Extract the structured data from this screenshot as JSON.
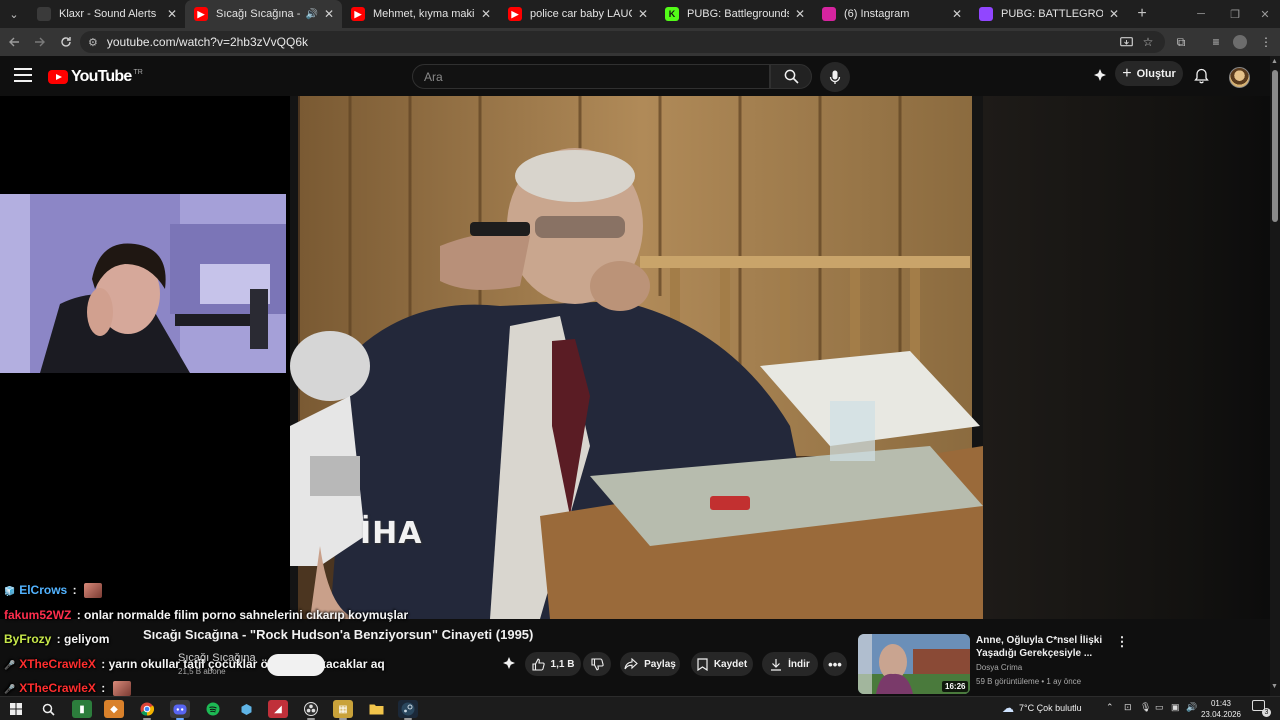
{
  "browser": {
    "tabs": [
      {
        "title": "Klaxr - Sound Alerts",
        "favicon": "globe-icon",
        "color": "#3a3a3a",
        "active": false
      },
      {
        "title": "Sıcağı Sıcağına - \"Rock Hudson'a Benziyorsun\" Cinayeti (1995)",
        "favicon": "youtube-icon",
        "color": "#ff0000",
        "active": true,
        "audio": true
      },
      {
        "title": "Mehmet, kıyma makinesi cinayeti",
        "favicon": "youtube-icon",
        "color": "#ff0000",
        "active": false
      },
      {
        "title": "police car baby LAUGH - YouTube",
        "favicon": "youtube-icon",
        "color": "#ff0000",
        "active": false
      },
      {
        "title": "PUBG: Battlegrounds Streaming",
        "favicon": "kick-icon",
        "color": "#53fc18",
        "active": false
      },
      {
        "title": "(6) Instagram",
        "favicon": "instagram-icon",
        "color": "#d6249f",
        "active": false
      },
      {
        "title": "PUBG: BATTLEGROUNDS - Twitch",
        "favicon": "twitch-icon",
        "color": "#9146ff",
        "active": false
      }
    ],
    "url": "youtube.com/watch?v=2hb3zVvQQ6k"
  },
  "youtube": {
    "country": "TR",
    "search_placeholder": "Ara",
    "create_label": "Oluştur"
  },
  "video": {
    "title": "Sıcağı Sıcağına - \"Rock Hudson'a Benziyorsun\" Cinayeti (1995)",
    "watermark": "İHA",
    "channel": "Sıcağı Sıcağına",
    "subscribers": "21,5 B abone",
    "likes": "1,1 B",
    "share_label": "Paylaş",
    "save_label": "Kaydet",
    "download_label": "İndir"
  },
  "chat": [
    {
      "user": "ElCrows",
      "color": "#52b3ff",
      "text": "",
      "emote": true,
      "badge": "🧊"
    },
    {
      "user": "fakum52WZ",
      "color": "#ff2e4d",
      "text": "onlar normalde filim porno sahnelerini cıkarıp koymuşlar",
      "emote": false,
      "badge": ""
    },
    {
      "user": "ByFrozy",
      "color": "#c7e84a",
      "text": "geliyom",
      "emote": false,
      "badge": ""
    },
    {
      "user": "XTheCrawleX",
      "color": "#ff2e2e",
      "text": "yarın okullar tatil çocuklar ölüyor korkacaklar aq",
      "emote": false,
      "badge": "🎤"
    },
    {
      "user": "XTheCrawleX",
      "color": "#ff2e2e",
      "text": "",
      "emote": true,
      "badge": "🎤"
    }
  ],
  "related": {
    "title": "Anne, Oğluyla C*nsel İlişki Yaşadığı Gerekçesiyle ...",
    "channel": "Dosya Crima",
    "views": "59 B görüntüleme",
    "age": "1 ay önce",
    "duration": "16:26"
  },
  "taskbar": {
    "weather": "7°C  Çok bulutlu",
    "time": "01:43",
    "date": "23.04.2026",
    "notifications": "3"
  }
}
